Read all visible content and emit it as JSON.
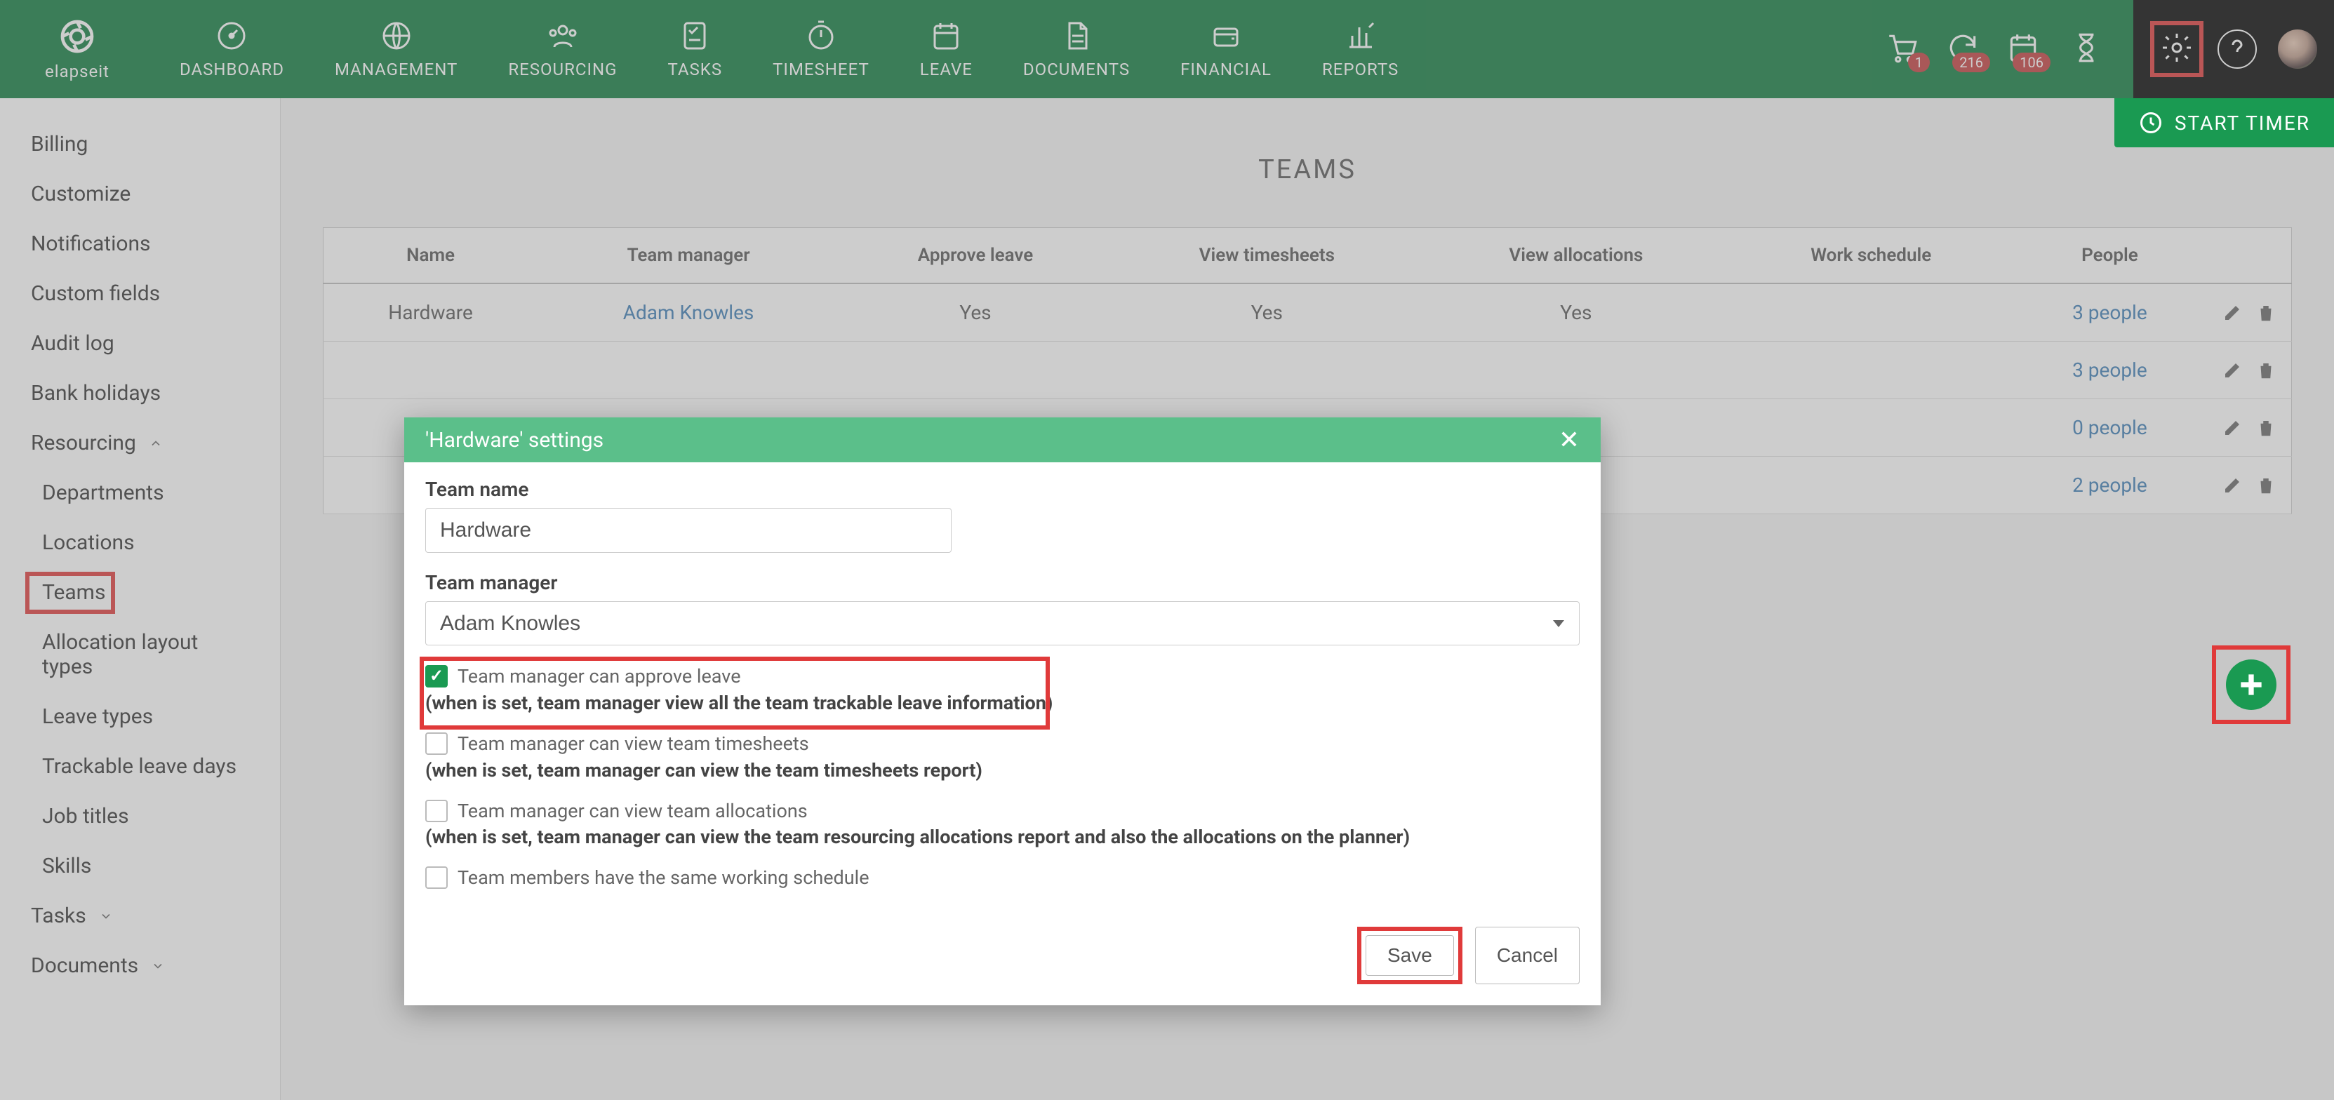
{
  "brand": "elapseit",
  "nav": {
    "dashboard": "DASHBOARD",
    "management": "MANAGEMENT",
    "resourcing": "RESOURCING",
    "tasks": "TASKS",
    "timesheet": "TIMESHEET",
    "leave": "LEAVE",
    "documents": "DOCUMENTS",
    "financial": "FINANCIAL",
    "reports": "REPORTS"
  },
  "badges": {
    "b1": "1",
    "b2": "216",
    "b3": "106"
  },
  "start_timer": "START TIMER",
  "sidebar": {
    "billing": "Billing",
    "customize": "Customize",
    "notifications": "Notifications",
    "custom_fields": "Custom fields",
    "audit_log": "Audit log",
    "bank_holidays": "Bank holidays",
    "resourcing": "Resourcing",
    "departments": "Departments",
    "locations": "Locations",
    "teams": "Teams",
    "allocation_layout": "Allocation layout types",
    "leave_types": "Leave types",
    "trackable": "Trackable leave days",
    "job_titles": "Job titles",
    "skills": "Skills",
    "tasks": "Tasks",
    "documents": "Documents"
  },
  "page_title": "TEAMS",
  "table": {
    "headers": {
      "name": "Name",
      "manager": "Team manager",
      "approve": "Approve leave",
      "view_ts": "View timesheets",
      "view_alloc": "View allocations",
      "schedule": "Work schedule",
      "people": "People"
    },
    "rows": [
      {
        "name": "Hardware",
        "manager": "Adam Knowles",
        "approve": "Yes",
        "view_ts": "Yes",
        "view_alloc": "Yes",
        "schedule": "",
        "people": "3 people"
      },
      {
        "name": "",
        "manager": "",
        "approve": "",
        "view_ts": "",
        "view_alloc": "",
        "schedule": "",
        "people": "3 people"
      },
      {
        "name": "",
        "manager": "",
        "approve": "",
        "view_ts": "",
        "view_alloc": "",
        "schedule": "",
        "people": "0 people"
      },
      {
        "name": "",
        "manager": "",
        "approve": "",
        "view_ts": "",
        "view_alloc": "",
        "schedule": "",
        "people": "2 people"
      }
    ]
  },
  "modal": {
    "title": "'Hardware' settings",
    "team_name_label": "Team name",
    "team_name_value": "Hardware",
    "team_manager_label": "Team manager",
    "team_manager_value": "Adam Knowles",
    "c1_label": "Team manager can approve leave",
    "c1_sub": "(when is set, team manager view all the team trackable leave information)",
    "c2_label": "Team manager can view team timesheets",
    "c2_sub": "(when is set, team manager can view the team timesheets report)",
    "c3_label": "Team manager can view team allocations",
    "c3_sub": "(when is set, team manager can view the team resourcing allocations report and also the allocations on the planner)",
    "c4_label": "Team members have the same working schedule",
    "save": "Save",
    "cancel": "Cancel"
  }
}
